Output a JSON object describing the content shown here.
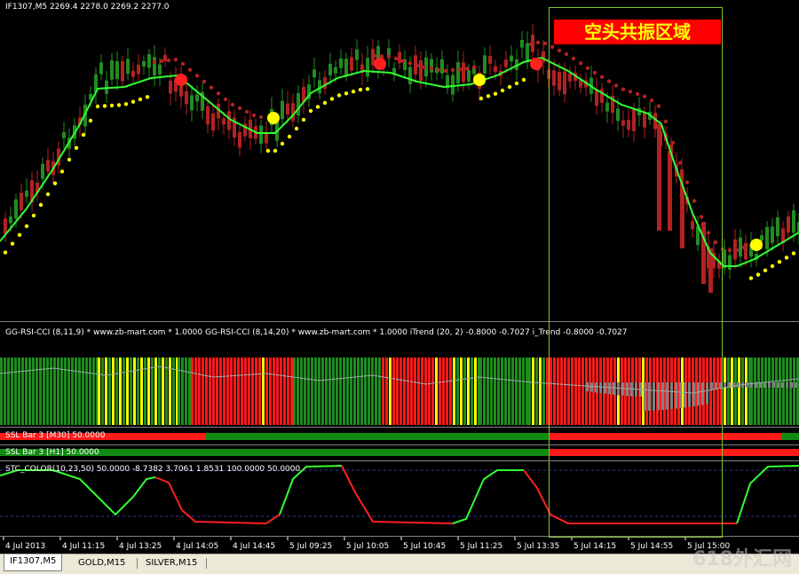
{
  "main_chart": {
    "title": "IF1307,M5  2269.4 2278.0 2269.2 2277.0",
    "annotation": "空头共振区域",
    "annotation_color": "#ff0000",
    "annotation_text_color": "#ffff00"
  },
  "indicator_rsi_cci": {
    "label": "GG-RSI-CCI (8,11,9) * www.zb-mart.com *  1.0000  GG-RSI-CCI (8,14,20) * www.zb-mart.com *  1.0000  iTrend (20, 2) -0.8000 -0.7027  i_Trend -0.8000 -0.7027"
  },
  "ssl_m30": {
    "label": "SSL Bar 3 [M30] 50.0000"
  },
  "ssl_h1": {
    "label": "SSL Bar 3 [H1] 50.0000"
  },
  "stc": {
    "label": "STC_COLOR(10,23,50) 50.0000 -8.7382 3.7061 1.8531 100.0000 50.0000"
  },
  "time_axis": {
    "ticks": [
      "4 Jul 2013",
      "4 Jul 11:15",
      "4 Jul 13:25",
      "4 Jul 14:05",
      "4 Jul 14:45",
      "5 Jul 09:25",
      "5 Jul 10:05",
      "5 Jul 10:45",
      "5 Jul 11:25",
      "5 Jul 13:35",
      "5 Jul 14:15",
      "5 Jul 14:55",
      "5 Jul 15:00"
    ]
  },
  "tabs": {
    "items": [
      {
        "label": "IF1307,M5",
        "active": true
      },
      {
        "label": "GOLD,M15",
        "active": false
      },
      {
        "label": "SILVER,M15",
        "active": false
      }
    ]
  },
  "watermark": "618外汇网",
  "colors": {
    "bull": "#228b22",
    "bear": "#b22222",
    "trend": "#32ff32",
    "dot_yellow": "#ffff00",
    "dot_red": "#ff2020"
  }
}
